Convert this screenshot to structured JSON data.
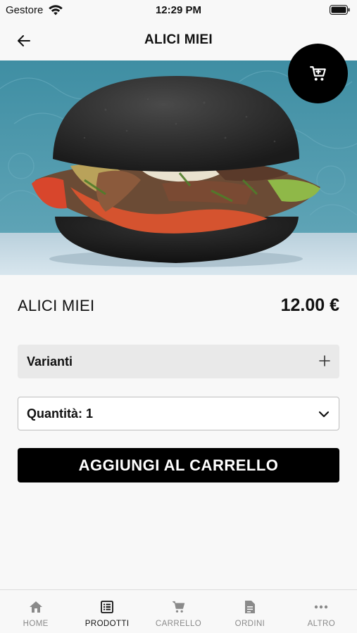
{
  "status_bar": {
    "carrier": "Gestore",
    "time": "12:29 PM"
  },
  "nav": {
    "title": "ALICI MIEI",
    "back_icon": "arrow-left-icon"
  },
  "hero": {
    "image": "black-bun-burger-photo",
    "pages": 1,
    "current_page": 1,
    "cart_icon": "cart-icon"
  },
  "product": {
    "name": "ALICI MIEI",
    "price": "12.00 €"
  },
  "variants": {
    "label": "Varianti",
    "icon": "plus-icon"
  },
  "quantity": {
    "label": "Quantità: 1",
    "icon": "chevron-down-icon"
  },
  "add_to_cart": {
    "label": "AGGIUNGI AL CARRELLO"
  },
  "tabs": [
    {
      "label": "HOME",
      "icon": "home-icon",
      "active": false
    },
    {
      "label": "PRODOTTI",
      "icon": "list-icon",
      "active": true
    },
    {
      "label": "CARRELLO",
      "icon": "cart-icon",
      "active": false
    },
    {
      "label": "ORDINI",
      "icon": "document-icon",
      "active": false
    },
    {
      "label": "ALTRO",
      "icon": "more-icon",
      "active": false
    }
  ],
  "colors": {
    "accent": "#000000",
    "background": "#f8f8f8",
    "hero_bg": "#3b8ba0",
    "inactive_tab": "#8a8a8a"
  }
}
